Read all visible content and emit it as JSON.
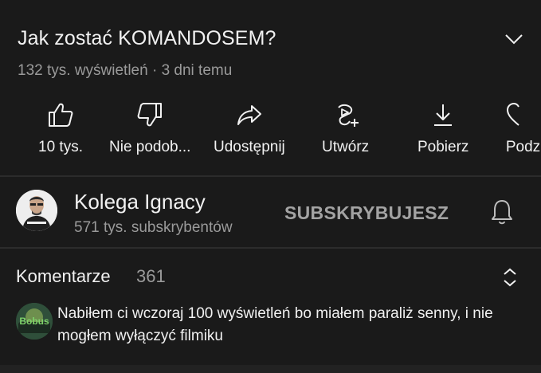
{
  "video": {
    "title": "Jak zostać KOMANDOSEM?",
    "meta": "132 tys. wyświetleń · 3 dni temu"
  },
  "actions": [
    {
      "label": "10 tys.",
      "icon": "thumbs-up-icon"
    },
    {
      "label": "Nie podob...",
      "icon": "thumbs-down-icon"
    },
    {
      "label": "Udostępnij",
      "icon": "share-icon"
    },
    {
      "label": "Utwórz",
      "icon": "create-remix-icon"
    },
    {
      "label": "Pobierz",
      "icon": "download-icon"
    },
    {
      "label": "Podz",
      "icon": "thanks-icon"
    }
  ],
  "channel": {
    "name": "Kolega Ignacy",
    "subscribers": "571 tys. subskrybentów",
    "subscribe_label": "SUBSKRYBUJESZ"
  },
  "comments": {
    "header": "Komentarze",
    "count": "361",
    "top_comment": {
      "text": "Nabiłem ci wczoraj 100 wyświetleń bo miałem paraliż senny, i nie mogłem wyłączyć filmiku",
      "avatar_label": "Bobus"
    }
  },
  "colors": {
    "background": "#1a1a1a",
    "text_primary": "#f1f1f1",
    "text_secondary": "#9a9a9a",
    "divider": "#2c2c2c"
  }
}
